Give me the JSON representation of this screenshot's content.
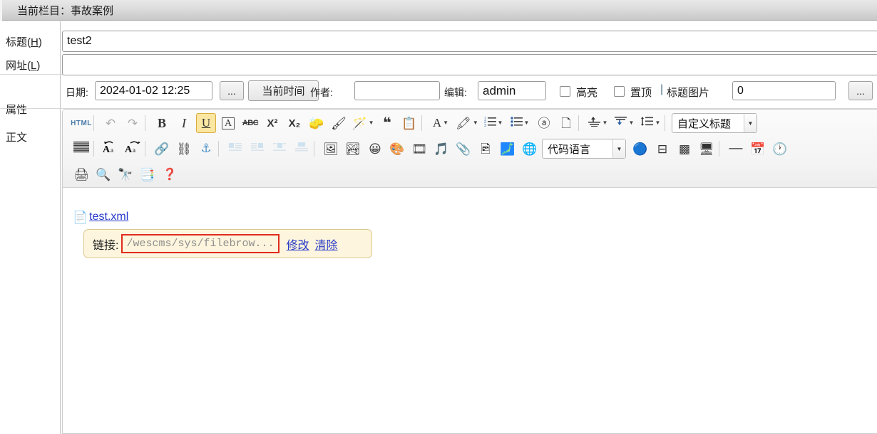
{
  "titlebar": {
    "text": "当前栏目：事故案例"
  },
  "labels": {
    "title": "标题(H)",
    "url": "网址(L)",
    "attributes": "属性",
    "body": "正文"
  },
  "fields": {
    "title_value": "test2",
    "title_placeholder": "",
    "url_value": "",
    "url_placeholder": "",
    "date_label": "日期:",
    "date_value": "2024-01-02 12:25",
    "dots_button_1": "...",
    "now_button": "当前时间",
    "author_label": "作者:",
    "author_value": "",
    "editor_label": "编辑:",
    "editor_value": "admin",
    "highlight_label": "高亮",
    "pin_label": "置顶",
    "separator": "|",
    "title_image_label": "标题图片",
    "title_image_value": "0",
    "dots_button_2": "..."
  },
  "toolbar": {
    "row1": [
      {
        "name": "source-html-button",
        "glyph": "HTML",
        "kind": "html"
      },
      {
        "name": "separator",
        "kind": "sep"
      },
      {
        "name": "undo-icon",
        "glyph": "↶",
        "kind": "icon",
        "faded": true
      },
      {
        "name": "redo-icon",
        "glyph": "↷",
        "kind": "icon",
        "faded": true
      },
      {
        "name": "separator",
        "kind": "sep"
      },
      {
        "name": "bold-icon",
        "glyph": "B",
        "kind": "bold"
      },
      {
        "name": "italic-icon",
        "glyph": "I",
        "kind": "italic"
      },
      {
        "name": "underline-icon",
        "glyph": "U",
        "kind": "underline",
        "active": true
      },
      {
        "name": "remove-format-icon",
        "glyph": "A",
        "kind": "boxed"
      },
      {
        "name": "strikethrough-icon",
        "glyph": "ABC",
        "kind": "strike"
      },
      {
        "name": "superscript-icon",
        "glyph": "X²",
        "kind": "sup"
      },
      {
        "name": "subscript-icon",
        "glyph": "X₂",
        "kind": "sub"
      },
      {
        "name": "eraser-icon",
        "glyph": "🧽",
        "kind": "emoji"
      },
      {
        "name": "paintbrush-icon",
        "glyph": "🖌",
        "kind": "emoji"
      },
      {
        "name": "magic-wand-icon",
        "glyph": "🪄",
        "kind": "emoji",
        "caret": true
      },
      {
        "name": "blockquote-icon",
        "glyph": "❝",
        "kind": "quote"
      },
      {
        "name": "paste-text-icon",
        "glyph": "📋",
        "kind": "emoji"
      },
      {
        "name": "separator",
        "kind": "sep"
      },
      {
        "name": "font-color-icon",
        "glyph": "A",
        "kind": "serifA",
        "caret": true
      },
      {
        "name": "background-color-icon",
        "glyph": "🖍",
        "kind": "emoji",
        "caret": true
      },
      {
        "name": "numbered-list-icon",
        "glyph": "list-num",
        "kind": "listnum",
        "caret": true
      },
      {
        "name": "bulleted-list-icon",
        "glyph": "list-bul",
        "kind": "listbul",
        "caret": true
      },
      {
        "name": "anchor-link-icon",
        "glyph": "ⓐ",
        "kind": "icon"
      },
      {
        "name": "page-break-icon",
        "glyph": "🗋",
        "kind": "emoji"
      },
      {
        "name": "separator",
        "kind": "sep"
      },
      {
        "name": "align-icon",
        "glyph": "align-up",
        "kind": "alignup",
        "caret": true
      },
      {
        "name": "indent-icon",
        "glyph": "align-dn",
        "kind": "aligndn",
        "caret": true
      },
      {
        "name": "line-height-icon",
        "glyph": "line-h",
        "kind": "lineh",
        "caret": true
      },
      {
        "name": "separator",
        "kind": "sep"
      },
      {
        "name": "custom-title-select",
        "glyph": "自定义标题",
        "kind": "select",
        "width": 120
      }
    ],
    "row2": [
      {
        "name": "justify-icon",
        "glyph": "≡",
        "kind": "justify"
      },
      {
        "name": "separator",
        "kind": "sep"
      },
      {
        "name": "decrease-font-icon",
        "glyph": "Aa↺",
        "kind": "fontdec"
      },
      {
        "name": "increase-font-icon",
        "glyph": "Aa↻",
        "kind": "fontinc"
      },
      {
        "name": "separator",
        "kind": "sep"
      },
      {
        "name": "insert-link-icon",
        "glyph": "🔗",
        "kind": "emoji"
      },
      {
        "name": "unlink-icon",
        "glyph": "⛓",
        "kind": "emoji"
      },
      {
        "name": "anchor-icon",
        "glyph": "⚓",
        "kind": "anchor"
      },
      {
        "name": "separator",
        "kind": "sep"
      },
      {
        "name": "image-align-left-icon",
        "glyph": "▤",
        "kind": "wrap",
        "faded": true
      },
      {
        "name": "image-align-right-icon",
        "glyph": "▥",
        "kind": "wrap",
        "faded": true
      },
      {
        "name": "image-align-center-icon",
        "glyph": "▦",
        "kind": "wrap",
        "faded": true
      },
      {
        "name": "image-align-none-icon",
        "glyph": "▧",
        "kind": "wrap",
        "faded": true
      },
      {
        "name": "separator",
        "kind": "sep"
      },
      {
        "name": "insert-image-icon",
        "glyph": "🖼",
        "kind": "emoji"
      },
      {
        "name": "insert-multi-image-icon",
        "glyph": "🏞",
        "kind": "emoji"
      },
      {
        "name": "insert-emoticon-icon",
        "glyph": "😀",
        "kind": "emoji"
      },
      {
        "name": "insert-doodle-icon",
        "glyph": "🎨",
        "kind": "emoji"
      },
      {
        "name": "insert-video-icon",
        "glyph": "🎞",
        "kind": "emoji"
      },
      {
        "name": "insert-music-icon",
        "glyph": "🎵",
        "kind": "emoji"
      },
      {
        "name": "insert-attachment-icon",
        "glyph": "📎",
        "kind": "emoji"
      },
      {
        "name": "insert-gallery-icon",
        "glyph": "🖻",
        "kind": "emoji"
      },
      {
        "name": "insert-photo-icon",
        "glyph": "🗾",
        "kind": "emoji"
      },
      {
        "name": "insert-webapp-icon",
        "glyph": "🌐",
        "kind": "emoji"
      },
      {
        "name": "code-language-select",
        "glyph": "代码语言",
        "kind": "select",
        "width": 118
      },
      {
        "name": "insert-flash-icon",
        "glyph": "🔵",
        "kind": "emoji"
      },
      {
        "name": "insert-iframe-icon",
        "glyph": "⊟",
        "kind": "icon"
      },
      {
        "name": "insert-table-icon",
        "glyph": "▩",
        "kind": "icon"
      },
      {
        "name": "insert-screenshot-icon",
        "glyph": "🖥",
        "kind": "emoji"
      },
      {
        "name": "separator",
        "kind": "sep"
      },
      {
        "name": "horizontal-rule-icon",
        "glyph": "—",
        "kind": "hr"
      },
      {
        "name": "insert-date-icon",
        "glyph": "📅",
        "kind": "emoji"
      },
      {
        "name": "insert-time-icon",
        "glyph": "🕐",
        "kind": "emoji"
      }
    ],
    "row3": [
      {
        "name": "print-icon",
        "glyph": "🖨",
        "kind": "emoji"
      },
      {
        "name": "preview-icon",
        "glyph": "🔍",
        "kind": "emoji"
      },
      {
        "name": "find-replace-icon",
        "glyph": "🔭",
        "kind": "emoji"
      },
      {
        "name": "templates-icon",
        "glyph": "📑",
        "kind": "emoji"
      },
      {
        "name": "help-icon",
        "glyph": "❓",
        "kind": "help"
      }
    ]
  },
  "content": {
    "file_icon": "📄",
    "file_name": "test.xml",
    "link_bubble": {
      "label": "链接:",
      "url": "/wescms/sys/filebrow...",
      "edit_label": "修改",
      "clear_label": "清除"
    }
  },
  "colors": {
    "accent_link": "#2437c8",
    "highlight_border": "#e02b1d",
    "bubble_bg": "#fdf5dd",
    "active_tool": "#fbe6a2"
  }
}
